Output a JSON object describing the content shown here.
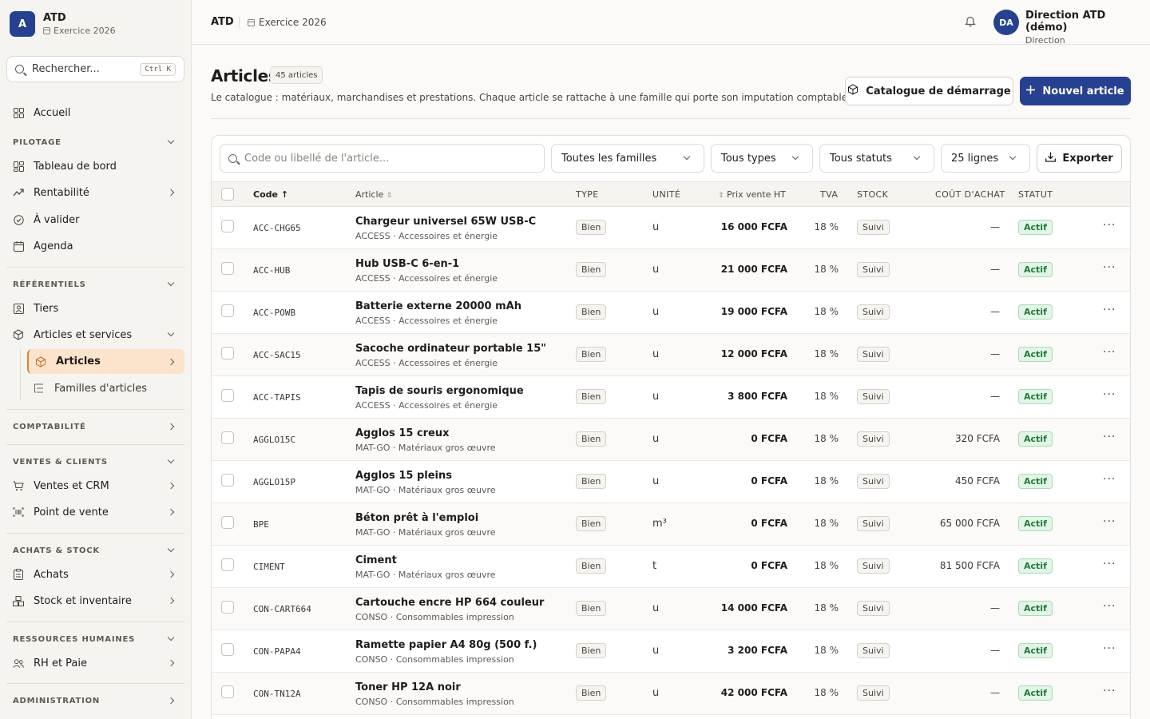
{
  "brand": {
    "initial": "A",
    "name": "ATD",
    "exercise": "Exercice 2026"
  },
  "sidebar": {
    "search_label": "Rechercher...",
    "search_shortcut": "Ctrl K",
    "home": "Accueil",
    "sections": {
      "pilotage": "PILOTAGE",
      "referentiels": "RÉFÉRENTIELS",
      "comptabilite": "COMPTABILITÉ",
      "ventes": "VENTES & CLIENTS",
      "achats": "ACHATS & STOCK",
      "rh": "RESSOURCES HUMAINES",
      "admin": "ADMINISTRATION"
    },
    "items": {
      "tableau": "Tableau de bord",
      "rentabilite": "Rentabilité",
      "a_valider": "À valider",
      "agenda": "Agenda",
      "tiers": "Tiers",
      "articles_services": "Articles et services",
      "articles": "Articles",
      "familles": "Familles d'articles",
      "ventes_crm": "Ventes et CRM",
      "pdv": "Point de vente",
      "achats": "Achats",
      "stock": "Stock et inventaire",
      "rh_paie": "RH et Paie"
    }
  },
  "topbar": {
    "crumb": "ATD",
    "exercise": "Exercice 2026",
    "user_initials": "DA",
    "user_name": "Direction ATD (démo)",
    "user_role": "Direction"
  },
  "page": {
    "title": "Articles",
    "count": "45 articles",
    "description": "Le catalogue : matériaux, marchandises et prestations. Chaque article se rattache à une famille qui porte son imputation comptable.",
    "btn_catalogue": "Catalogue de démarrage",
    "btn_new": "Nouvel article"
  },
  "filters": {
    "search_placeholder": "Code ou libellé de l'article...",
    "family": "Toutes les familles",
    "type": "Tous types",
    "status": "Tous statuts",
    "lines": "25 lignes",
    "export": "Exporter"
  },
  "table": {
    "headers": {
      "code": "Code",
      "article": "Article",
      "type": "TYPE",
      "unit": "UNITÉ",
      "price": "Prix vente HT",
      "tva": "TVA",
      "stock": "STOCK",
      "cost": "COÛT D'ACHAT",
      "status": "STATUT"
    },
    "rows": [
      {
        "code": "ACC-CHG65",
        "name": "Chargeur universel 65W USB-C",
        "family": "ACCESS · Accessoires et énergie",
        "type": "Bien",
        "unit": "u",
        "price": "16 000 FCFA",
        "tva": "18 %",
        "stock": "Suivi",
        "cost": "—",
        "status": "Actif"
      },
      {
        "code": "ACC-HUB",
        "name": "Hub USB-C 6-en-1",
        "family": "ACCESS · Accessoires et énergie",
        "type": "Bien",
        "unit": "u",
        "price": "21 000 FCFA",
        "tva": "18 %",
        "stock": "Suivi",
        "cost": "—",
        "status": "Actif"
      },
      {
        "code": "ACC-POWB",
        "name": "Batterie externe 20000 mAh",
        "family": "ACCESS · Accessoires et énergie",
        "type": "Bien",
        "unit": "u",
        "price": "19 000 FCFA",
        "tva": "18 %",
        "stock": "Suivi",
        "cost": "—",
        "status": "Actif"
      },
      {
        "code": "ACC-SAC15",
        "name": "Sacoche ordinateur portable 15\"",
        "family": "ACCESS · Accessoires et énergie",
        "type": "Bien",
        "unit": "u",
        "price": "12 000 FCFA",
        "tva": "18 %",
        "stock": "Suivi",
        "cost": "—",
        "status": "Actif"
      },
      {
        "code": "ACC-TAPIS",
        "name": "Tapis de souris ergonomique",
        "family": "ACCESS · Accessoires et énergie",
        "type": "Bien",
        "unit": "u",
        "price": "3 800 FCFA",
        "tva": "18 %",
        "stock": "Suivi",
        "cost": "—",
        "status": "Actif"
      },
      {
        "code": "AGGLO15C",
        "name": "Agglos 15 creux",
        "family": "MAT-GO · Matériaux gros œuvre",
        "type": "Bien",
        "unit": "u",
        "price": "0 FCFA",
        "tva": "18 %",
        "stock": "Suivi",
        "cost": "320 FCFA",
        "status": "Actif"
      },
      {
        "code": "AGGLO15P",
        "name": "Agglos 15 pleins",
        "family": "MAT-GO · Matériaux gros œuvre",
        "type": "Bien",
        "unit": "u",
        "price": "0 FCFA",
        "tva": "18 %",
        "stock": "Suivi",
        "cost": "450 FCFA",
        "status": "Actif"
      },
      {
        "code": "BPE",
        "name": "Béton prêt à l'emploi",
        "family": "MAT-GO · Matériaux gros œuvre",
        "type": "Bien",
        "unit": "m³",
        "price": "0 FCFA",
        "tva": "18 %",
        "stock": "Suivi",
        "cost": "65 000 FCFA",
        "status": "Actif"
      },
      {
        "code": "CIMENT",
        "name": "Ciment",
        "family": "MAT-GO · Matériaux gros œuvre",
        "type": "Bien",
        "unit": "t",
        "price": "0 FCFA",
        "tva": "18 %",
        "stock": "Suivi",
        "cost": "81 500 FCFA",
        "status": "Actif"
      },
      {
        "code": "CON-CART664",
        "name": "Cartouche encre HP 664 couleur",
        "family": "CONSO · Consommables impression",
        "type": "Bien",
        "unit": "u",
        "price": "14 000 FCFA",
        "tva": "18 %",
        "stock": "Suivi",
        "cost": "—",
        "status": "Actif"
      },
      {
        "code": "CON-PAPA4",
        "name": "Ramette papier A4 80g (500 f.)",
        "family": "CONSO · Consommables impression",
        "type": "Bien",
        "unit": "u",
        "price": "3 200 FCFA",
        "tva": "18 %",
        "stock": "Suivi",
        "cost": "—",
        "status": "Actif"
      },
      {
        "code": "CON-TN12A",
        "name": "Toner HP 12A noir",
        "family": "CONSO · Consommables impression",
        "type": "Bien",
        "unit": "u",
        "price": "42 000 FCFA",
        "tva": "18 %",
        "stock": "Suivi",
        "cost": "—",
        "status": "Actif"
      }
    ]
  }
}
